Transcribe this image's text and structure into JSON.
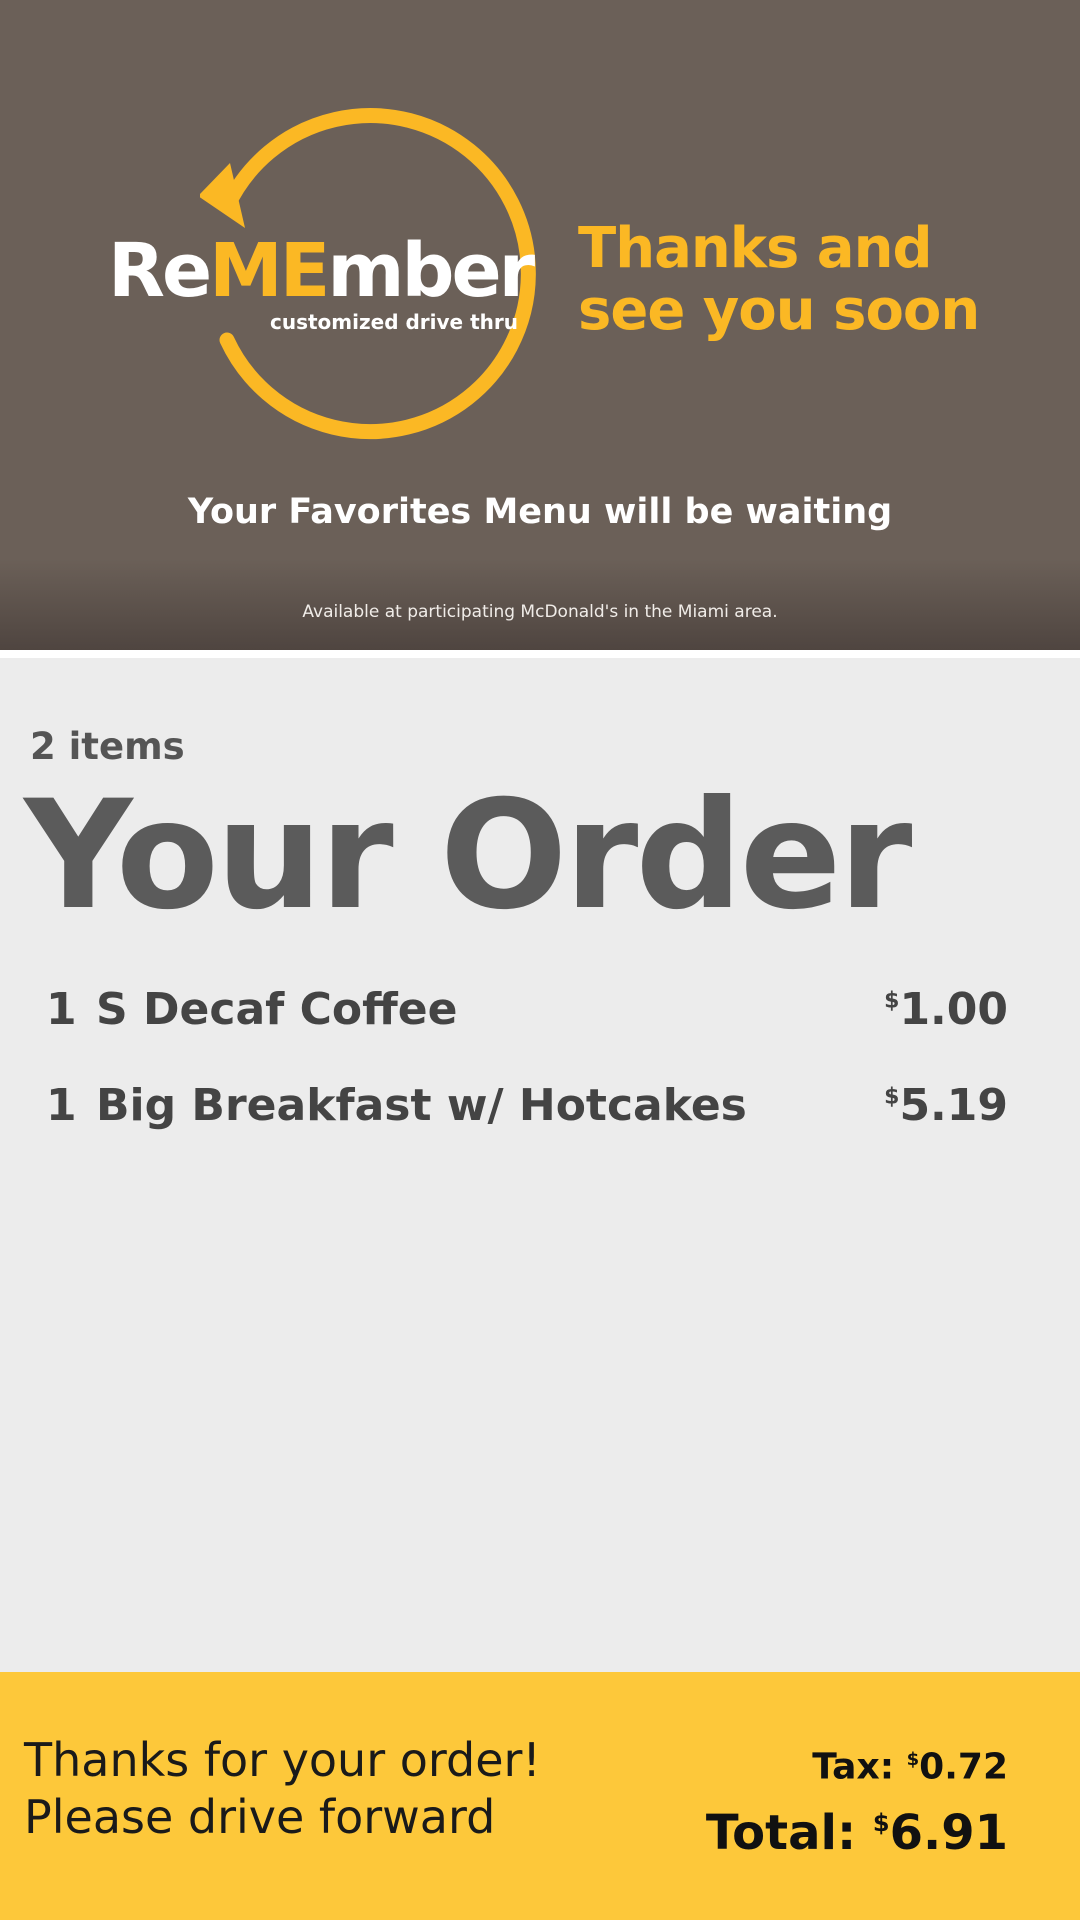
{
  "promo": {
    "logo": {
      "part1": "Re",
      "part2": "ME",
      "part3": "mber",
      "tagline": "customized drive thru"
    },
    "headline_line1": "Thanks and",
    "headline_line2": "see you soon",
    "favorites_text": "Your Favorites Menu will be waiting",
    "disclaimer": "Available at participating McDonald's in the Miami area."
  },
  "order": {
    "item_count": "2 items",
    "title": "Your Order",
    "items": [
      {
        "qty": "1",
        "name": "S Decaf Coffee",
        "currency": "$",
        "price": "1.00"
      },
      {
        "qty": "1",
        "name": "Big Breakfast w/ Hotcakes",
        "currency": "$",
        "price": "5.19"
      }
    ]
  },
  "footer": {
    "message_line1": "Thanks for your order!",
    "message_line2": "Please drive forward",
    "tax_label": "Tax:",
    "tax_currency": "$",
    "tax_value": "0.72",
    "total_label": "Total:",
    "total_currency": "$",
    "total_value": "6.91"
  },
  "colors": {
    "promo_bg": "#6b6058",
    "accent_yellow": "#fbb824",
    "footer_bg": "#fdc83a",
    "body_bg": "#ececec",
    "order_text": "#444444"
  },
  "icons": {
    "logo_ring": "circular-arrow-icon"
  }
}
